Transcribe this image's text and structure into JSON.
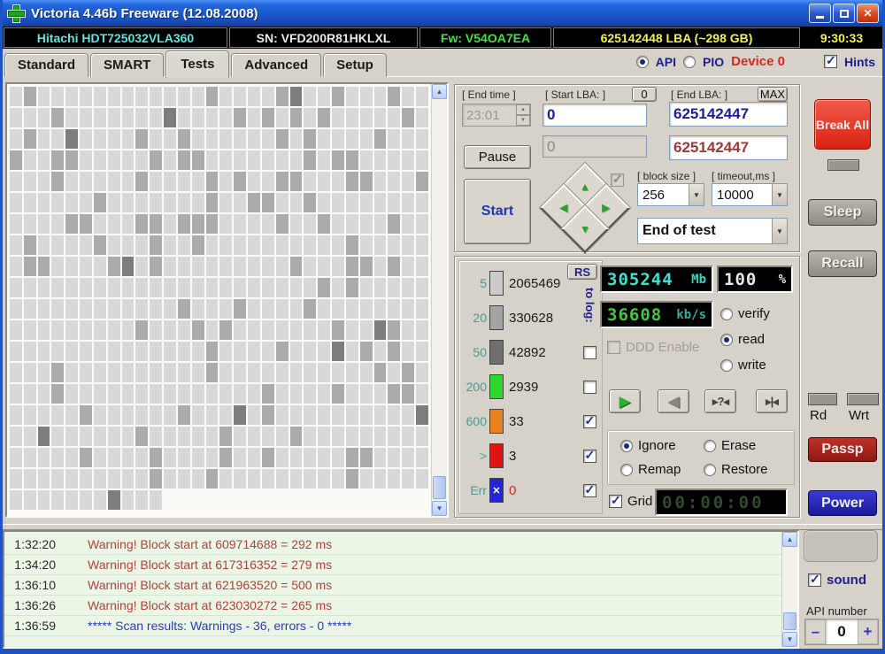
{
  "window": {
    "title": "Victoria 4.46b Freeware (12.08.2008)"
  },
  "info_bar": {
    "model": "Hitachi HDT725032VLA360",
    "serial": "SN: VFD200R81HKLXL",
    "firmware": "Fw: V54OA7EA",
    "capacity": "625142448 LBA (~298 GB)",
    "clock": "9:30:33"
  },
  "tabs": {
    "items": [
      "Standard",
      "SMART",
      "Tests",
      "Advanced",
      "Setup"
    ],
    "active": "Tests"
  },
  "mode": {
    "api": "API",
    "pio": "PIO",
    "selected": "API",
    "device": "Device 0",
    "hints": "Hints",
    "hints_checked": true
  },
  "controls": {
    "end_time_label": "[ End time ]",
    "end_time_value": "23:01",
    "start_lba_label": "[ Start LBA: ]",
    "zero_button": "0",
    "end_lba_label": "[ End LBA: ]",
    "max_button": "MAX",
    "start_lba_value": "0",
    "start_lba_shadow": "0",
    "end_lba_value": "625142447",
    "end_lba_current": "625142447",
    "pause_button": "Pause",
    "start_button": "Start",
    "nav": {
      "up": "▲",
      "left": "◀",
      "right": "▶",
      "down": "▼"
    },
    "block_size_label": "[ block size ]",
    "block_size_value": "256",
    "timeout_label": "[ timeout,ms ]",
    "timeout_value": "10000",
    "on_end_value": "End of test"
  },
  "histogram": {
    "rs_button": "RS",
    "to_log_label": "to log:",
    "rows": [
      {
        "label": "5",
        "color": "#cbcbcb",
        "count": "2065469",
        "log": "none"
      },
      {
        "label": "20",
        "color": "#a3a3a3",
        "count": "330628",
        "log": "none"
      },
      {
        "label": "50",
        "color": "#6f6f6f",
        "count": "42892",
        "log": "unchecked"
      },
      {
        "label": "200",
        "color": "#2ed52e",
        "count": "2939",
        "log": "unchecked"
      },
      {
        "label": "600",
        "color": "#e8821e",
        "count": "33",
        "log": "checked"
      },
      {
        "label": ">",
        "color": "#e01212",
        "count": "3",
        "log": "checked"
      },
      {
        "label": "Err",
        "color": "#2424d8",
        "count": "0",
        "log": "checked",
        "err_mark": "✕",
        "count_color": "#cc2a22"
      }
    ]
  },
  "status": {
    "mb_value": "305244",
    "mb_unit": "Mb",
    "percent_value": "100",
    "percent_unit": "%",
    "speed_value": "36608",
    "speed_unit": "kb/s",
    "ddd_label": "DDD Enable",
    "verify": "verify",
    "read": "read",
    "write": "write",
    "selected_mode": "read"
  },
  "transport": {
    "play": "▶",
    "back": "◀",
    "seek_question": "▸?◂",
    "seek_end": "▸|◂"
  },
  "actions": {
    "ignore": "Ignore",
    "erase": "Erase",
    "remap": "Remap",
    "restore": "Restore",
    "selected": "Ignore",
    "grid_label": "Grid",
    "grid_checked": true,
    "timer": "00:00:00"
  },
  "sidebar": {
    "break_all": "Break All",
    "sleep": "Sleep",
    "recall": "Recall",
    "rd": "Rd",
    "wrt": "Wrt",
    "passp": "Passp",
    "power": "Power"
  },
  "log": {
    "entries": [
      {
        "time": "1:32:20",
        "text": "Warning! Block start at 609714688 = 292 ms",
        "type": "warning"
      },
      {
        "time": "1:34:20",
        "text": "Warning! Block start at 617316352 = 279 ms",
        "type": "warning"
      },
      {
        "time": "1:36:10",
        "text": "Warning! Block start at 621963520 = 500 ms",
        "type": "warning"
      },
      {
        "time": "1:36:26",
        "text": "Warning! Block start at 623030272 = 265 ms",
        "type": "warning"
      },
      {
        "time": "1:36:59",
        "text": "***** Scan results: Warnings - 36, errors - 0 *****",
        "type": "result"
      }
    ]
  },
  "misc": {
    "sound": "sound",
    "sound_checked": true,
    "api_number_label": "API number",
    "api_number_value": "0",
    "minus": "–",
    "plus": "+"
  },
  "scan_grid": {
    "cols": 30,
    "rows": 20,
    "last_row_cells": 11,
    "seed": 20080812,
    "colors": {
      "light": "#d8d8d8",
      "medium": "#ababab",
      "dark": "#7d7d7d"
    },
    "medium_ratio": 0.16,
    "dark_ratio": 0.015
  },
  "colors": {
    "title_blue": "#1d54c4",
    "accent_red": "#d92313",
    "lcd_cyan": "#3fe0d0",
    "lcd_green": "#3fca3f",
    "lcd_teal": "#2fae9e",
    "lcd_dim": "#2f4a2f",
    "value_navy": "#1c1c9c",
    "value_darkred": "#9c3a32",
    "log_warning": "#b2423a",
    "log_result": "#2b3bbd"
  }
}
